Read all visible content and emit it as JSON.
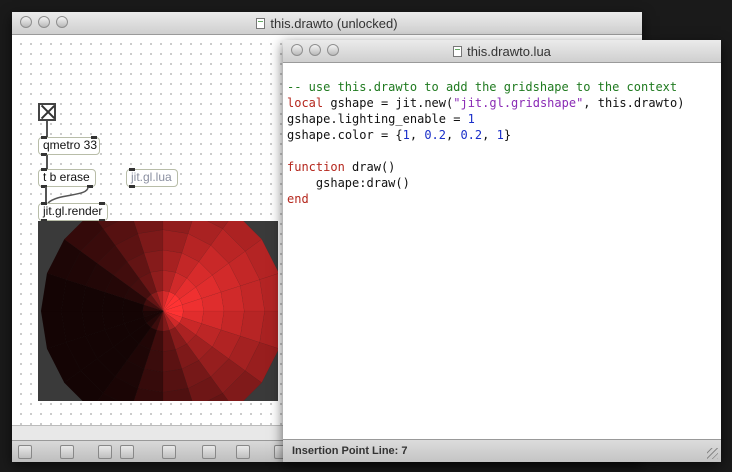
{
  "patcher_window": {
    "title": "this.drawto (unlocked)",
    "objects": {
      "qmetro": "qmetro 33",
      "trigger": "t b erase",
      "lua": "jit.gl.lua",
      "render": "jit.gl.render"
    }
  },
  "editor_window": {
    "title": "this.drawto.lua",
    "code_lines": [
      "-- use this.drawto to add the gridshape to the context",
      "local gshape = jit.new(\"jit.gl.gridshape\", this.drawto)",
      "gshape.lighting_enable = 1",
      "gshape.color = {1, 0.2, 0.2, 1}",
      "",
      "function draw()",
      "    gshape:draw()",
      "end"
    ],
    "status": "Insertion Point Line: 7"
  },
  "colors": {
    "comment": "#1f7a1f",
    "keyword": "#b5271d",
    "string": "#8a2bb5",
    "number": "#1a2fc9",
    "shape": "#ff3333"
  },
  "icons": [
    "lock-icon",
    "new-object-icon",
    "palette-icon",
    "clear-icon",
    "inspector-icon",
    "info-icon",
    "cord-icon",
    "grid-icon"
  ]
}
